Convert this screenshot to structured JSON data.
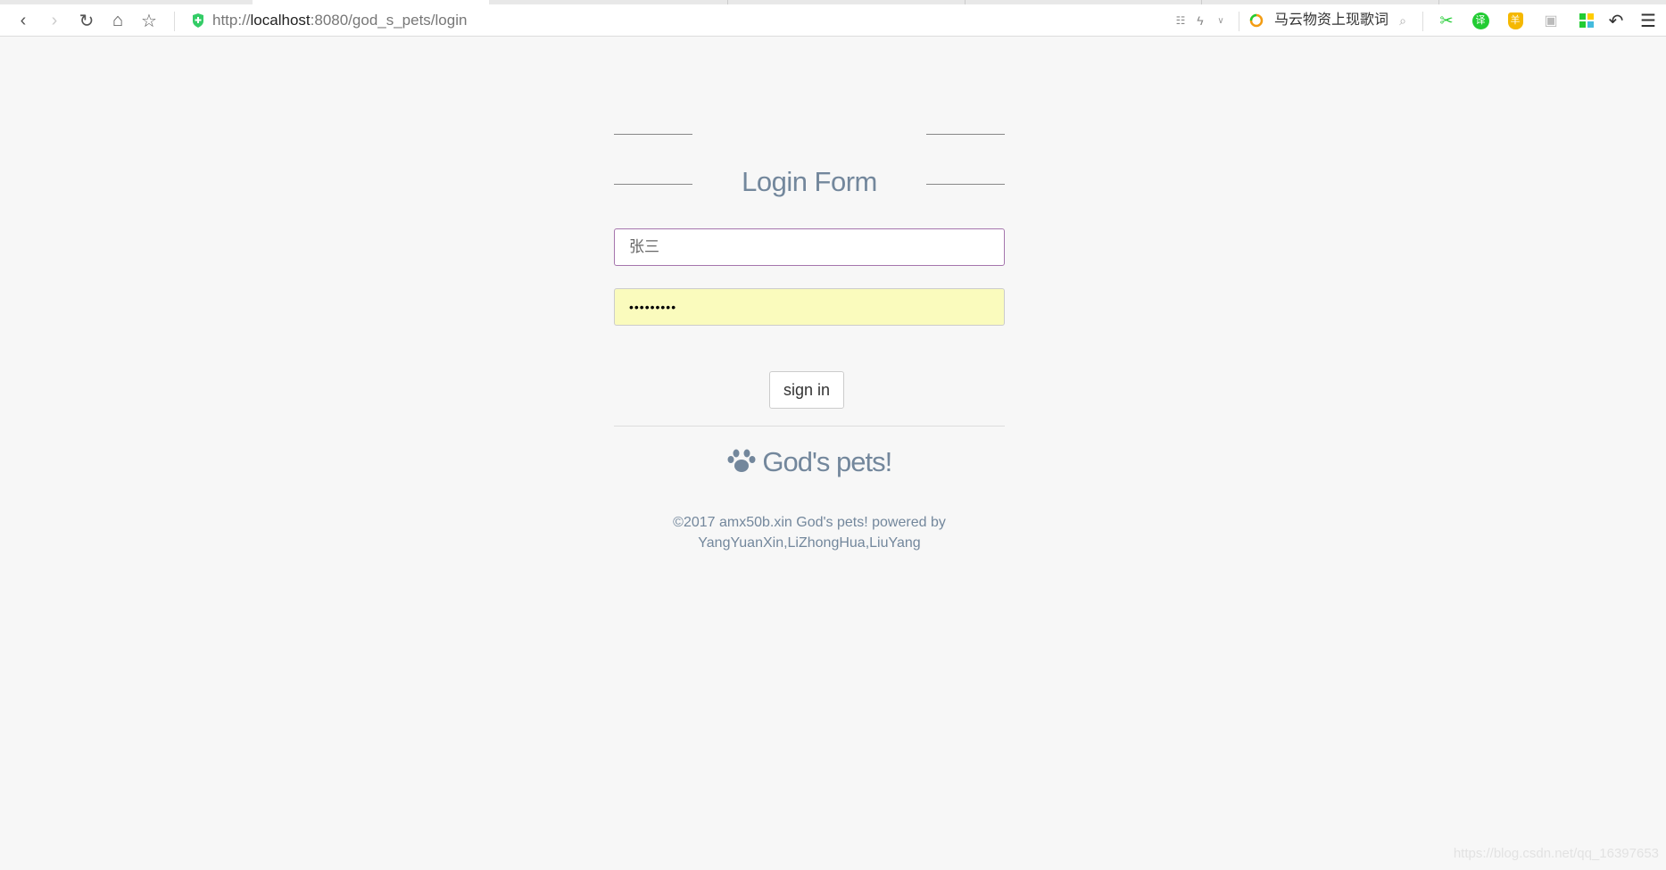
{
  "browser": {
    "url_prefix": "http://",
    "url_host": "localhost",
    "url_rest": ":8080/god_s_pets/login",
    "search_text": "马云物资上现歌词",
    "icons": [
      "back-icon",
      "forward-icon",
      "reload-icon",
      "home-icon",
      "star-icon",
      "shield-icon",
      "qr-icon",
      "lightning-icon",
      "chevron-down-icon",
      "search-icon",
      "scissors-icon",
      "translate-icon",
      "wallet-icon",
      "game-icon",
      "apps-icon",
      "undo-icon",
      "menu-icon"
    ]
  },
  "form": {
    "title": "Login Form",
    "username_value": "张三",
    "password_value": "•••••••••",
    "submit_label": "sign in"
  },
  "brand": {
    "name": "God's pets!",
    "icon": "paw-icon"
  },
  "footer": {
    "line1": "©2017 amx50b.xin God's pets! powered by",
    "line2": "YangYuanXin,LiZhongHua,LiuYang"
  },
  "watermark": "https://blog.csdn.net/qq_16397653",
  "colors": {
    "accent": "#73879c",
    "username_border": "#a575ad",
    "password_bg": "#fafbbd"
  }
}
